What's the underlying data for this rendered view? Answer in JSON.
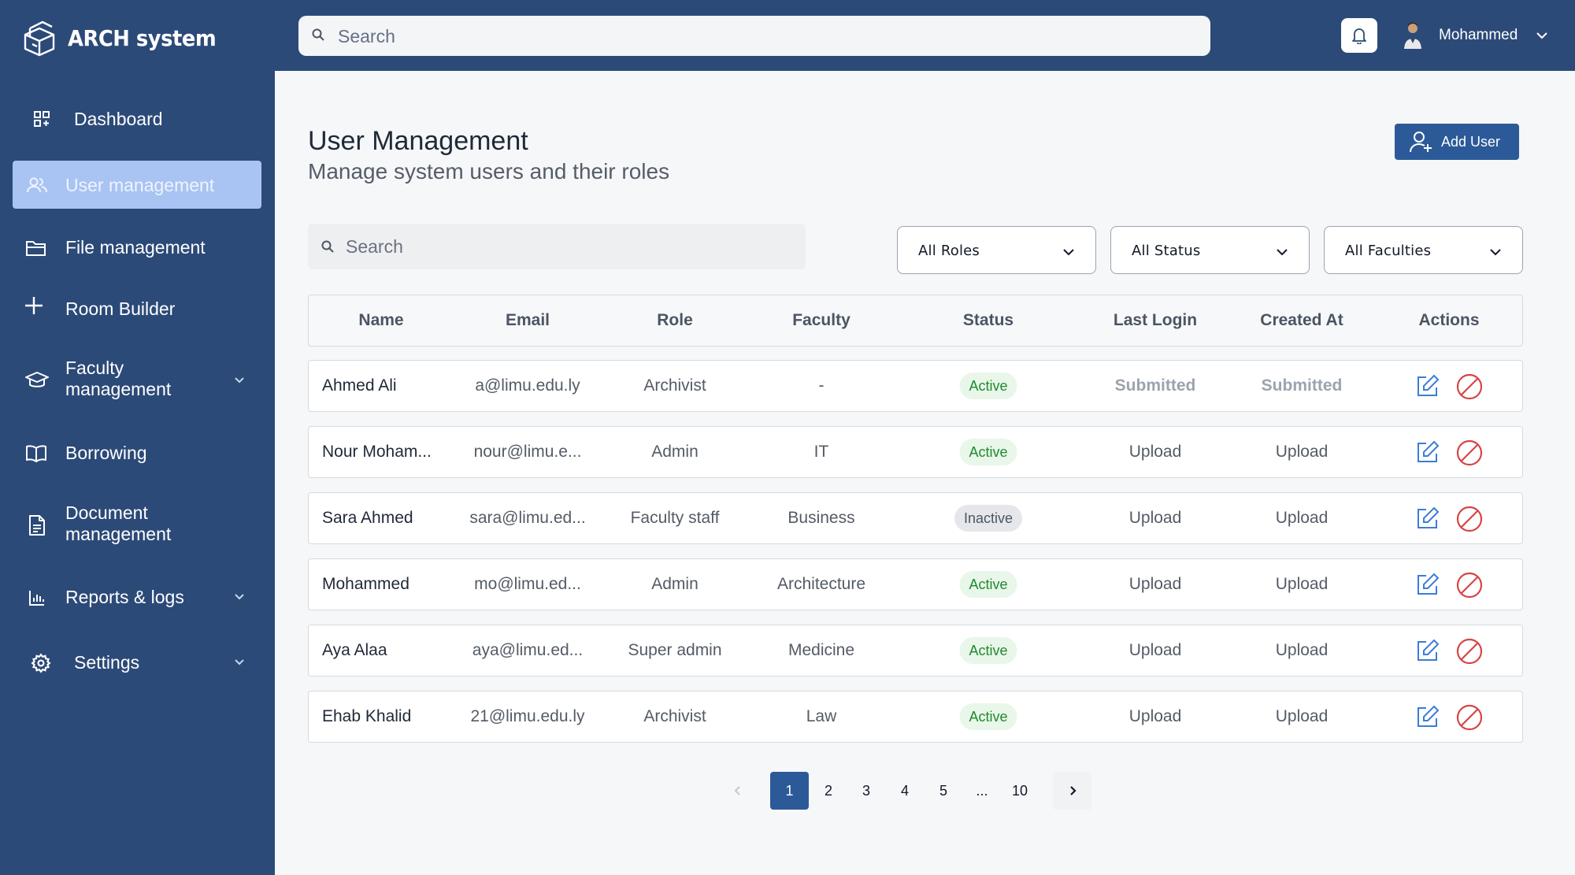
{
  "app": {
    "name": "ARCH system"
  },
  "sidebar": {
    "items": [
      {
        "label": "Dashboard",
        "icon": "dashboard-icon"
      },
      {
        "label": "User management",
        "icon": "users-icon",
        "active": true
      },
      {
        "label": "File management",
        "icon": "folder-icon"
      },
      {
        "label": "Room Builder",
        "icon": "plus-icon"
      },
      {
        "label": "Faculty\nmanagement",
        "icon": "graduation-cap-icon",
        "has_children": true
      },
      {
        "label": "Borrowing",
        "icon": "book-open-icon"
      },
      {
        "label": "Document\nmanagement",
        "icon": "document-icon"
      },
      {
        "label": "Reports & logs",
        "icon": "bar-chart-icon",
        "has_children": true
      },
      {
        "label": "Settings",
        "icon": "gear-icon",
        "has_children": true
      }
    ]
  },
  "topbar": {
    "search_placeholder": "Search",
    "user_name": "Mohammed"
  },
  "page": {
    "title": "User Management",
    "subtitle": "Manage system users and their roles",
    "add_user_label": "Add User"
  },
  "filters": {
    "search_placeholder": "Search",
    "roles": "All Roles",
    "status": "All Status",
    "faculties": "All Faculties"
  },
  "table": {
    "columns": [
      "Name",
      "Email",
      "Role",
      "Faculty",
      "Status",
      "Last Login",
      "Created At",
      "Actions"
    ],
    "rows": [
      {
        "name": "Ahmed Ali",
        "email": "a@limu.edu.ly",
        "role": "Archivist",
        "faculty": "-",
        "status": "Active",
        "last_login": "Submitted",
        "created_at": "Submitted"
      },
      {
        "name": "Nour Moham...",
        "email": "nour@limu.e...",
        "role": "Admin",
        "faculty": "IT",
        "status": "Active",
        "last_login": "Upload",
        "created_at": "Upload"
      },
      {
        "name": "Sara Ahmed",
        "email": "sara@limu.ed...",
        "role": "Faculty staff",
        "faculty": "Business",
        "status": "Inactive",
        "last_login": "Upload",
        "created_at": "Upload"
      },
      {
        "name": "Mohammed",
        "email": "mo@limu.ed...",
        "role": "Admin",
        "faculty": "Architecture",
        "status": "Active",
        "last_login": "Upload",
        "created_at": "Upload"
      },
      {
        "name": "Aya Alaa",
        "email": "aya@limu.ed...",
        "role": "Super admin",
        "faculty": "Medicine",
        "status": "Active",
        "last_login": "Upload",
        "created_at": "Upload"
      },
      {
        "name": "Ehab Khalid",
        "email": "21@limu.edu.ly",
        "role": "Archivist",
        "faculty": "Law",
        "status": "Active",
        "last_login": "Upload",
        "created_at": "Upload"
      }
    ]
  },
  "pagination": {
    "pages": [
      "1",
      "2",
      "3",
      "4",
      "5",
      "...",
      "10"
    ],
    "current": "1"
  },
  "colors": {
    "sidebar_bg": "#2c4a78",
    "active_nav": "#a9c4f2",
    "primary_button": "#2c5a98",
    "active_badge_text": "#1f8a2c",
    "block_icon": "#d64545",
    "edit_icon": "#3b7dd8"
  }
}
